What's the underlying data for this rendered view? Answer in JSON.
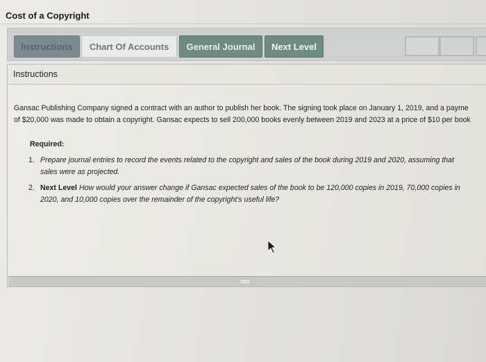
{
  "page": {
    "title": "Cost of a Copyright"
  },
  "tabs": [
    {
      "label": "Instructions",
      "active": true
    },
    {
      "label": "Chart Of Accounts",
      "active": false
    },
    {
      "label": "General Journal",
      "active": false
    },
    {
      "label": "Next Level",
      "active": false
    }
  ],
  "panel": {
    "header": "Instructions",
    "paragraph_line1": "Gansac Publishing Company signed a contract with an author to publish her book. The signing took place on January 1, 2019, and a payme",
    "paragraph_line2": "of $20,000 was made to obtain a copyright. Gansac expects to sell 200,000 books evenly between 2019 and 2023 at a price of $10 per book",
    "required_label": "Required:",
    "items": [
      {
        "number": "1.",
        "lead": "",
        "text_line1": "Prepare journal entries to record the events related to the copyright and sales of the book during 2019 and 2020, assuming that",
        "text_line2": "sales were as projected."
      },
      {
        "number": "2.",
        "lead": "Next Level",
        "text_line1": " How would your answer change if Gansac expected sales of the book to be 120,000 copies in 2019, 70,000 copies in",
        "text_line2": "2020, and 10,000 copies over the remainder of the copyright's useful life?"
      }
    ]
  },
  "colors": {
    "active_tab": "#7c8a92",
    "inactive_tab_light": "#e9eaea",
    "inactive_tab_green": "#6d8a83"
  }
}
